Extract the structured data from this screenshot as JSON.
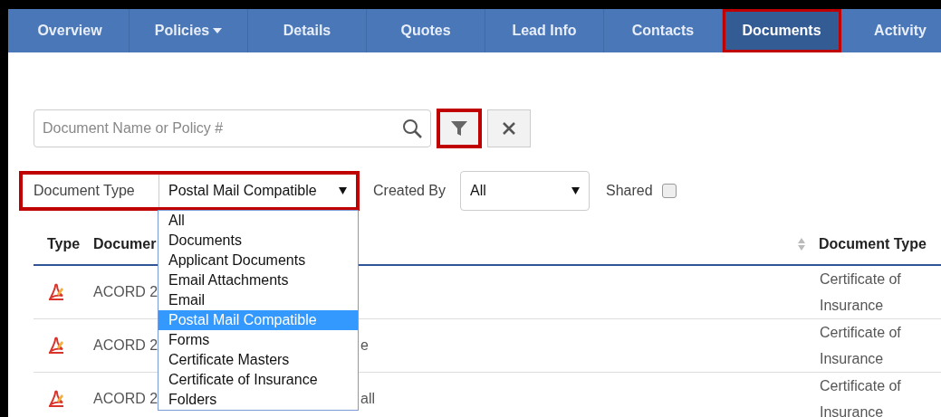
{
  "tabs": [
    {
      "label": "Overview",
      "selected": false,
      "highlighted": false
    },
    {
      "label": "Policies",
      "selected": false,
      "highlighted": false,
      "has_menu": true
    },
    {
      "label": "Details",
      "selected": false,
      "highlighted": false
    },
    {
      "label": "Quotes",
      "selected": false,
      "highlighted": false
    },
    {
      "label": "Lead Info",
      "selected": false,
      "highlighted": false
    },
    {
      "label": "Contacts",
      "selected": false,
      "highlighted": false
    },
    {
      "label": "Documents",
      "selected": true,
      "highlighted": true
    },
    {
      "label": "Activity",
      "selected": false,
      "highlighted": false
    }
  ],
  "search": {
    "placeholder": "Document Name or Policy #",
    "filter_highlighted": true
  },
  "filters": {
    "document_type": {
      "label": "Document Type",
      "value": "Postal Mail Compatible",
      "highlighted": true,
      "expanded": true,
      "options": [
        {
          "label": "All",
          "selected": false
        },
        {
          "label": "Documents",
          "selected": false
        },
        {
          "label": "Applicant Documents",
          "selected": false
        },
        {
          "label": "Email Attachments",
          "selected": false
        },
        {
          "label": "Email",
          "selected": false
        },
        {
          "label": "Postal Mail Compatible",
          "selected": true
        },
        {
          "label": "Forms",
          "selected": false
        },
        {
          "label": "Certificate Masters",
          "selected": false
        },
        {
          "label": "Certificate of Insurance",
          "selected": false
        },
        {
          "label": "Folders",
          "selected": false
        }
      ]
    },
    "created_by": {
      "label": "Created By",
      "value": "All"
    },
    "shared": {
      "label": "Shared",
      "checked": false
    }
  },
  "table": {
    "columns": [
      "Type",
      "Documer",
      "Document Type"
    ],
    "rows": [
      {
        "name": "ACORD 2",
        "document_type": "Certificate of Insurance"
      },
      {
        "name": "ACORD 2",
        "name_tail": "e",
        "document_type": "Certificate of Insurance"
      },
      {
        "name": "ACORD 2",
        "name_tail": "all",
        "document_type": "Certificate of Insurance"
      }
    ]
  }
}
